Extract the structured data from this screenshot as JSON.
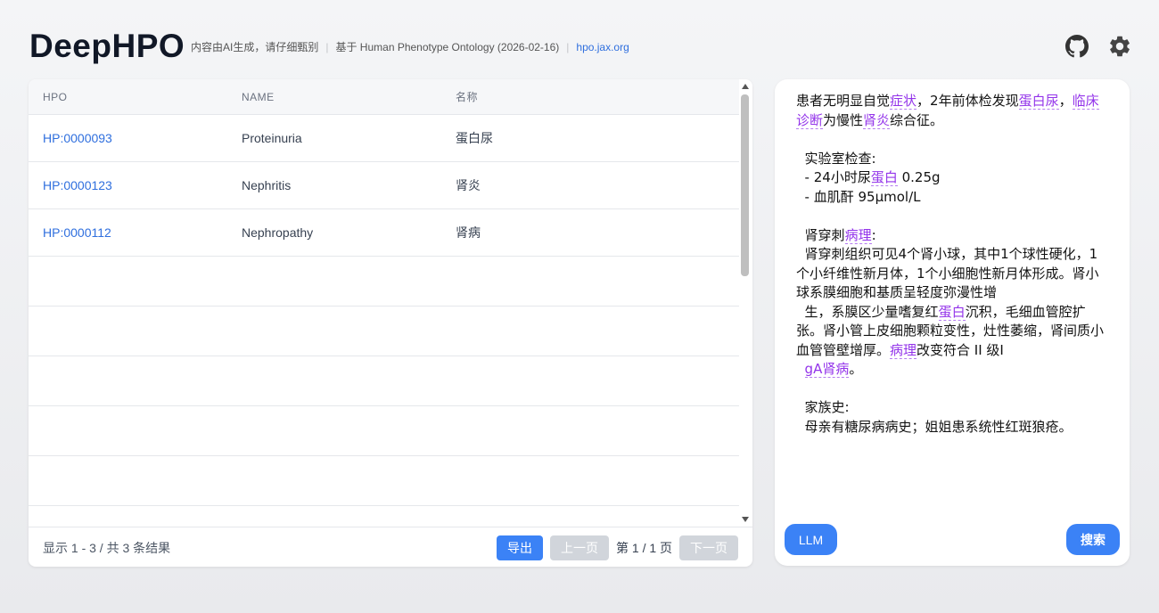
{
  "header": {
    "title": "DeepHPO",
    "disclaimer": "内容由AI生成，请仔细甄别",
    "ontology": "基于 Human Phenotype Ontology (2026-02-16)",
    "link": "hpo.jax.org",
    "icons": [
      "github-icon",
      "gear-icon"
    ]
  },
  "table": {
    "columns": [
      "HPO",
      "NAME",
      "名称"
    ],
    "rows": [
      {
        "hpo": "HP:0000093",
        "name": "Proteinuria",
        "cn": "蛋白尿"
      },
      {
        "hpo": "HP:0000123",
        "name": "Nephritis",
        "cn": "肾炎"
      },
      {
        "hpo": "HP:0000112",
        "name": "Nephropathy",
        "cn": "肾病"
      }
    ]
  },
  "footer": {
    "info": "显示 1 - 3 / 共 3 条结果",
    "export": "导出",
    "prev": "上一页",
    "page": "第 1 / 1 页",
    "next": "下一页"
  },
  "input": {
    "segments": [
      {
        "t": "患者无明显自觉"
      },
      {
        "t": "症状",
        "hl": true
      },
      {
        "t": "，2年前体检发现"
      },
      {
        "t": "蛋白尿",
        "hl": true
      },
      {
        "t": "，"
      },
      {
        "t": "临床诊断",
        "hl": true
      },
      {
        "t": "为慢性"
      },
      {
        "t": "肾炎",
        "hl": true
      },
      {
        "t": "综合征。\n\n  实验室检查:\n  - 24小时尿"
      },
      {
        "t": "蛋白",
        "hl": true
      },
      {
        "t": " 0.25g\n  - 血肌酐 95μmol/L\n\n  肾穿刺"
      },
      {
        "t": "病理",
        "hl": true
      },
      {
        "t": ":\n  肾穿刺组织可见4个肾小球，其中1个球性硬化，1个小纤维性新月体，1个小细胞性新月体形成。肾小球系膜细胞和基质呈轻度弥漫性增\n  生，系膜区少量嗜复红"
      },
      {
        "t": "蛋白",
        "hl": true
      },
      {
        "t": "沉积，毛细血管腔扩张。肾小管上皮细胞颗粒变性，灶性萎缩，肾间质小血管管壁增厚。"
      },
      {
        "t": "病理",
        "hl": true
      },
      {
        "t": "改变符合 II 级I\n  "
      },
      {
        "t": "gA肾病",
        "hl": true
      },
      {
        "t": "。\n\n  家族史:\n  母亲有糖尿病病史；姐姐患系统性红斑狼疮。"
      }
    ],
    "llm_button": "LLM",
    "search_button": "搜索"
  }
}
